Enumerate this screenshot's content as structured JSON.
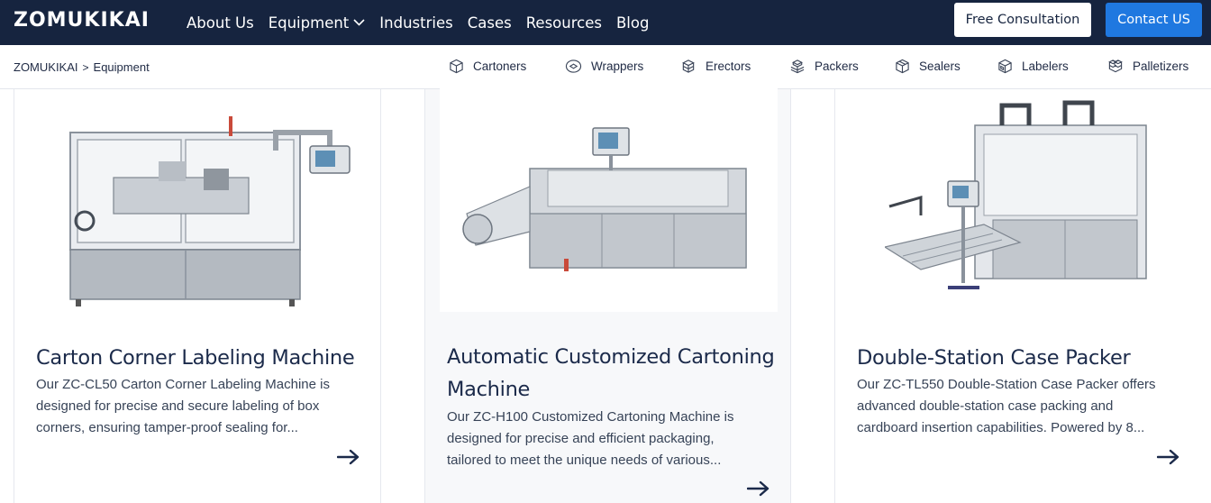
{
  "header": {
    "logo": "ZOMUKIKAI",
    "nav": [
      {
        "label": "About Us"
      },
      {
        "label": "Equipment",
        "has_dropdown": true
      },
      {
        "label": "Industries"
      },
      {
        "label": "Cases"
      },
      {
        "label": "Resources"
      },
      {
        "label": "Blog"
      }
    ],
    "consult_label": "Free Consultation",
    "contact_label": "Contact US"
  },
  "breadcrumb": {
    "home": "ZOMUKIKAI",
    "separator": ">",
    "current": "Equipment"
  },
  "categories": [
    {
      "label": "Cartoners",
      "icon": "box-icon"
    },
    {
      "label": "Wrappers",
      "icon": "wrap-icon"
    },
    {
      "label": "Erectors",
      "icon": "boxes-icon"
    },
    {
      "label": "Packers",
      "icon": "packer-icon"
    },
    {
      "label": "Sealers",
      "icon": "box-seal-icon"
    },
    {
      "label": "Labelers",
      "icon": "label-box-icon"
    },
    {
      "label": "Palletizers",
      "icon": "pallet-icon"
    }
  ],
  "products": [
    {
      "title_lines": [
        "Carton Corner Labeling Machine"
      ],
      "desc_lines": [
        "Our ZC-CL50 Carton Corner Labeling Machine is",
        "designed for precise and secure labeling of box",
        "corners, ensuring tamper-proof sealing for..."
      ]
    },
    {
      "title_lines": [
        "Automatic Customized Cartoning",
        "Machine"
      ],
      "desc_lines": [
        "Our ZC-H100 Customized Cartoning Machine is",
        "designed for precise and efficient packaging,",
        "tailored to meet the unique needs of various..."
      ]
    },
    {
      "title_lines": [
        "Double-Station Case Packer"
      ],
      "desc_lines": [
        "Our ZC-TL550 Double-Station Case Packer offers",
        "advanced double-station case packing and",
        "cardboard insertion capabilities. Powered by 8..."
      ]
    }
  ],
  "colors": {
    "nav_bg": "#16243f",
    "accent": "#1f78e0",
    "title": "#1b2a4a"
  }
}
